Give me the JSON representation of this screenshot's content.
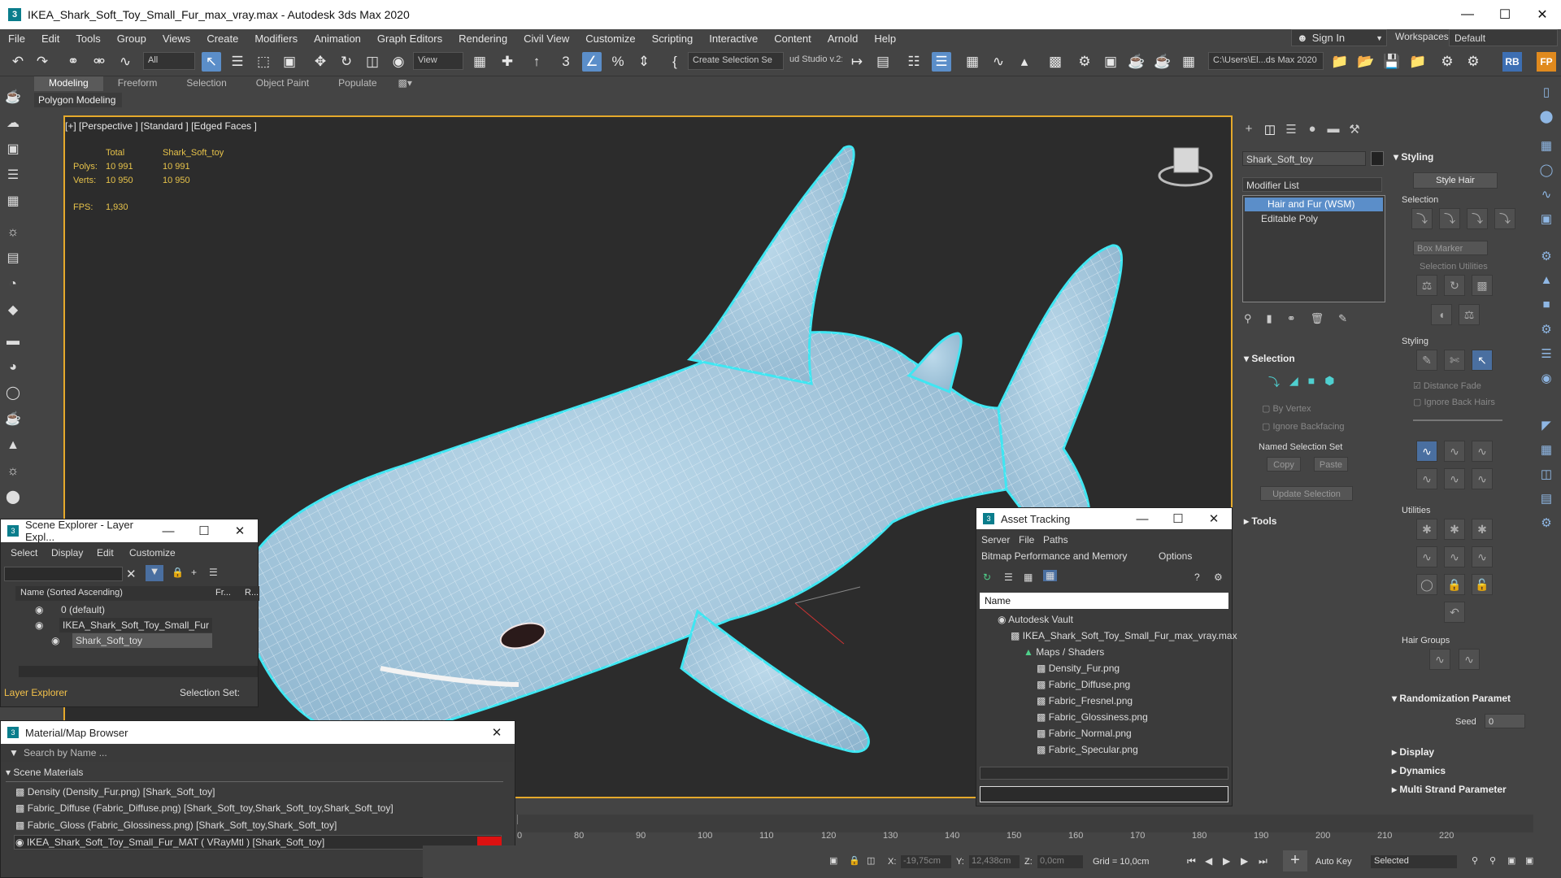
{
  "window": {
    "title": "IKEA_Shark_Soft_Toy_Small_Fur_max_vray.max - Autodesk 3ds Max 2020",
    "app_icon": "3"
  },
  "menu": [
    "File",
    "Edit",
    "Tools",
    "Group",
    "Views",
    "Create",
    "Modifiers",
    "Animation",
    "Graph Editors",
    "Rendering",
    "Civil View",
    "Customize",
    "Scripting",
    "Interactive",
    "Content",
    "Arnold",
    "Help"
  ],
  "account": {
    "sign_in": "Sign In",
    "workspaces_label": "Workspaces:",
    "workspace": "Default"
  },
  "toolbar": {
    "filter": "All",
    "view": "View",
    "create_selection_set": "Create Selection Se",
    "studio": "ud Studio v.2:",
    "path": "C:\\Users\\El...ds Max 2020",
    "rb": "RB",
    "fp": "FP"
  },
  "ribbon": {
    "tabs": [
      "Modeling",
      "Freeform",
      "Selection",
      "Object Paint",
      "Populate"
    ],
    "active": "Modeling",
    "sub": "Polygon Modeling"
  },
  "viewport": {
    "label": "[+] [Perspective ] [Standard ] [Edged Faces ]",
    "stats": {
      "total_label": "Total",
      "object_label": "Shark_Soft_toy",
      "polys_label": "Polys:",
      "polys_total": "10 991",
      "polys_obj": "10 991",
      "verts_label": "Verts:",
      "verts_total": "10 950",
      "verts_obj": "10 950",
      "fps_label": "FPS:",
      "fps": "1,930"
    }
  },
  "command_panel": {
    "object_name": "Shark_Soft_toy",
    "modifier_list": "Modifier List",
    "stack": [
      "Hair and Fur (WSM)",
      "Editable Poly"
    ],
    "selection": {
      "title": "Selection",
      "by_vertex": "By Vertex",
      "ignore_backfacing": "Ignore Backfacing",
      "named_set": "Named Selection Set",
      "copy": "Copy",
      "paste": "Paste",
      "update": "Update Selection"
    },
    "tools": "Tools"
  },
  "styling_panel": {
    "title": "Styling",
    "style_hair": "Style Hair",
    "selection": "Selection",
    "box_marker": "Box Marker",
    "selection_utilities": "Selection Utilities",
    "styling": "Styling",
    "distance_fade": "Distance Fade",
    "ignore_back_hairs": "Ignore Back Hairs",
    "utilities": "Utilities",
    "hair_groups": "Hair Groups",
    "randomization": "Randomization Paramet",
    "seed_label": "Seed",
    "seed": "0",
    "display": "Display",
    "dynamics": "Dynamics",
    "multi_strand": "Multi Strand Parameter"
  },
  "scene_explorer": {
    "title": "Scene Explorer - Layer Expl...",
    "menu": [
      "Select",
      "Display",
      "Edit",
      "Customize"
    ],
    "col_name": "Name (Sorted Ascending)",
    "col_fr": "Fr...",
    "col_r": "R...",
    "rows": [
      "0 (default)",
      "IKEA_Shark_Soft_Toy_Small_Fur",
      "Shark_Soft_toy"
    ],
    "footer_left": "Layer Explorer",
    "footer_right": "Selection Set:"
  },
  "material_browser": {
    "title": "Material/Map Browser",
    "search": "Search by Name ...",
    "group": "Scene Materials",
    "items": [
      "Density (Density_Fur.png) [Shark_Soft_toy]",
      "Fabric_Diffuse (Fabric_Diffuse.png) [Shark_Soft_toy,Shark_Soft_toy,Shark_Soft_toy]",
      "Fabric_Gloss (Fabric_Glossiness.png) [Shark_Soft_toy,Shark_Soft_toy]",
      "IKEA_Shark_Soft_Toy_Small_Fur_MAT ( VRayMtl ) [Shark_Soft_toy]"
    ]
  },
  "asset_tracking": {
    "title": "Asset Tracking",
    "menu": [
      "Server",
      "File",
      "Paths"
    ],
    "menu2": [
      "Bitmap Performance and Memory",
      "Options"
    ],
    "col_name": "Name",
    "rows": [
      "Autodesk Vault",
      "IKEA_Shark_Soft_Toy_Small_Fur_max_vray.max",
      "Maps / Shaders",
      "Density_Fur.png",
      "Fabric_Diffuse.png",
      "Fabric_Fresnel.png",
      "Fabric_Glossiness.png",
      "Fabric_Normal.png",
      "Fabric_Specular.png"
    ]
  },
  "timeline": {
    "ticks": [
      "80",
      "90",
      "100",
      "110",
      "120",
      "130",
      "140",
      "150",
      "160",
      "170",
      "180",
      "190",
      "200",
      "210",
      "220"
    ],
    "first": "0"
  },
  "status": {
    "x_label": "X:",
    "x": "-19,75cm",
    "y_label": "Y:",
    "y": "12,438cm",
    "z_label": "Z:",
    "z": "0,0cm",
    "grid": "Grid = 10,0cm",
    "auto_key": "Auto Key",
    "selected": "Selected"
  },
  "colors": {
    "accent": "#5b8ec9",
    "viewport_border": "#e5a92b",
    "shark": "#a9cbe0",
    "wire": "#e8f2f8",
    "highlight": "#3fe6f2"
  }
}
